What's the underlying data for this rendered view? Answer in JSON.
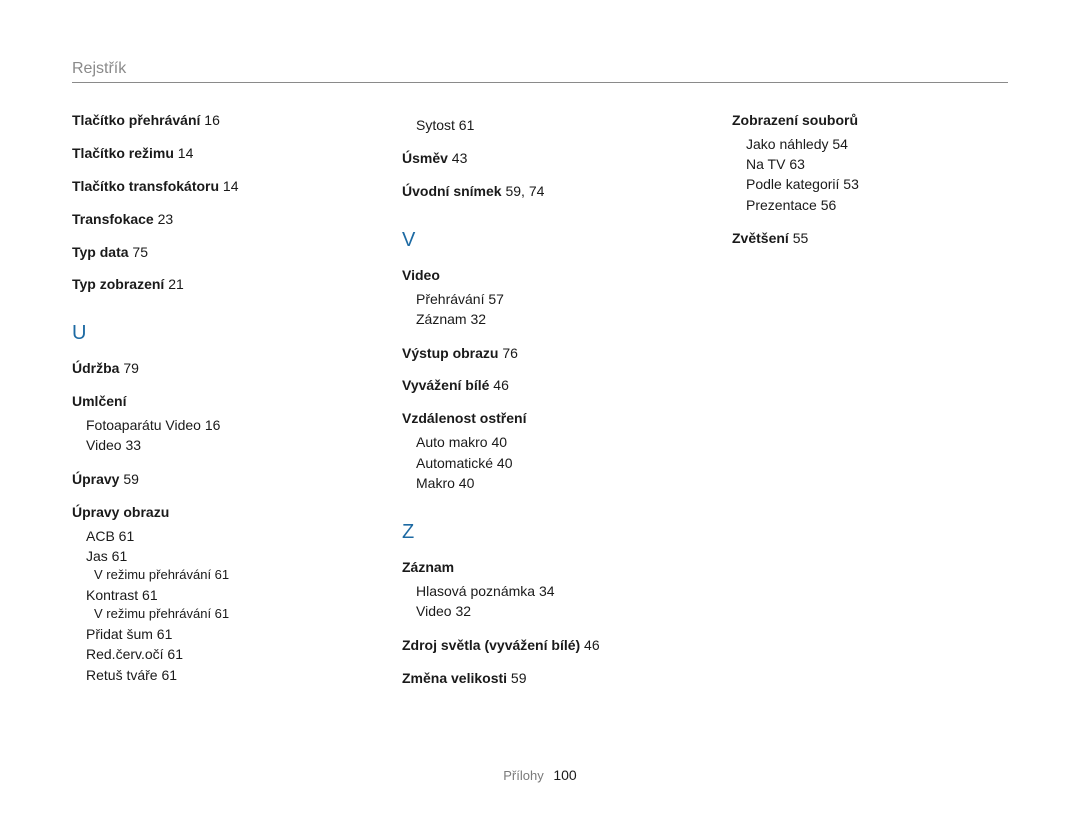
{
  "header": {
    "title": "Rejstřík"
  },
  "footer": {
    "section": "Přílohy",
    "page_number": "100"
  },
  "columns": [
    {
      "blocks": [
        {
          "entries": [
            {
              "term": "Tlačítko přehrávání",
              "pages": "16"
            },
            {
              "term": "Tlačítko režimu",
              "pages": "14"
            },
            {
              "term": "Tlačítko transfokátoru",
              "pages": "14"
            },
            {
              "term": "Transfokace",
              "pages": "23"
            },
            {
              "term": "Typ data",
              "pages": "75"
            },
            {
              "term": "Typ zobrazení",
              "pages": "21"
            }
          ]
        },
        {
          "letter": "U",
          "entries": [
            {
              "term": "Údržba",
              "pages": "79"
            },
            {
              "term": "Umlčení",
              "subs": [
                {
                  "text": "Fotoaparátu Video",
                  "pages": "16"
                },
                {
                  "text": "Video",
                  "pages": "33"
                }
              ]
            },
            {
              "term": "Úpravy",
              "pages": "59"
            },
            {
              "term": "Úpravy obrazu",
              "subs": [
                {
                  "text": "ACB",
                  "pages": "61"
                },
                {
                  "text": "Jas",
                  "pages": "61",
                  "subsubs": [
                    {
                      "text": "V režimu přehrávání",
                      "pages": "61"
                    }
                  ]
                },
                {
                  "text": "Kontrast",
                  "pages": "61",
                  "subsubs": [
                    {
                      "text": "V režimu přehrávání",
                      "pages": "61"
                    }
                  ]
                },
                {
                  "text": "Přidat šum",
                  "pages": "61"
                },
                {
                  "text": "Red.červ.očí",
                  "pages": "61"
                },
                {
                  "text": "Retuš tváře",
                  "pages": "61"
                }
              ]
            }
          ]
        }
      ]
    },
    {
      "blocks": [
        {
          "entries": [
            {
              "sub_only": true,
              "text": "Sytost",
              "pages": "61"
            },
            {
              "term": "Úsměv",
              "pages": "43"
            },
            {
              "term": "Úvodní snímek",
              "pages": "59, 74"
            }
          ]
        },
        {
          "letter": "V",
          "entries": [
            {
              "term": "Video",
              "subs": [
                {
                  "text": "Přehrávání",
                  "pages": "57"
                },
                {
                  "text": "Záznam",
                  "pages": "32"
                }
              ]
            },
            {
              "term": "Výstup obrazu",
              "pages": "76"
            },
            {
              "term": "Vyvážení bílé",
              "pages": "46"
            },
            {
              "term": "Vzdálenost ostření",
              "subs": [
                {
                  "text": "Auto makro",
                  "pages": "40"
                },
                {
                  "text": "Automatické",
                  "pages": "40"
                },
                {
                  "text": "Makro",
                  "pages": "40"
                }
              ]
            }
          ]
        },
        {
          "letter": "Z",
          "entries": [
            {
              "term": "Záznam",
              "subs": [
                {
                  "text": "Hlasová poznámka",
                  "pages": "34"
                },
                {
                  "text": "Video",
                  "pages": "32"
                }
              ]
            },
            {
              "term": "Zdroj světla (vyvážení bílé)",
              "pages": "46"
            },
            {
              "term": "Změna velikosti",
              "pages": "59"
            }
          ]
        }
      ]
    },
    {
      "blocks": [
        {
          "entries": [
            {
              "term": "Zobrazení souborů",
              "subs": [
                {
                  "text": "Jako náhledy",
                  "pages": "54"
                },
                {
                  "text": "Na TV",
                  "pages": "63"
                },
                {
                  "text": "Podle kategorií",
                  "pages": "53"
                },
                {
                  "text": "Prezentace",
                  "pages": "56"
                }
              ]
            },
            {
              "term": "Zvětšení",
              "pages": "55"
            }
          ]
        }
      ]
    }
  ]
}
